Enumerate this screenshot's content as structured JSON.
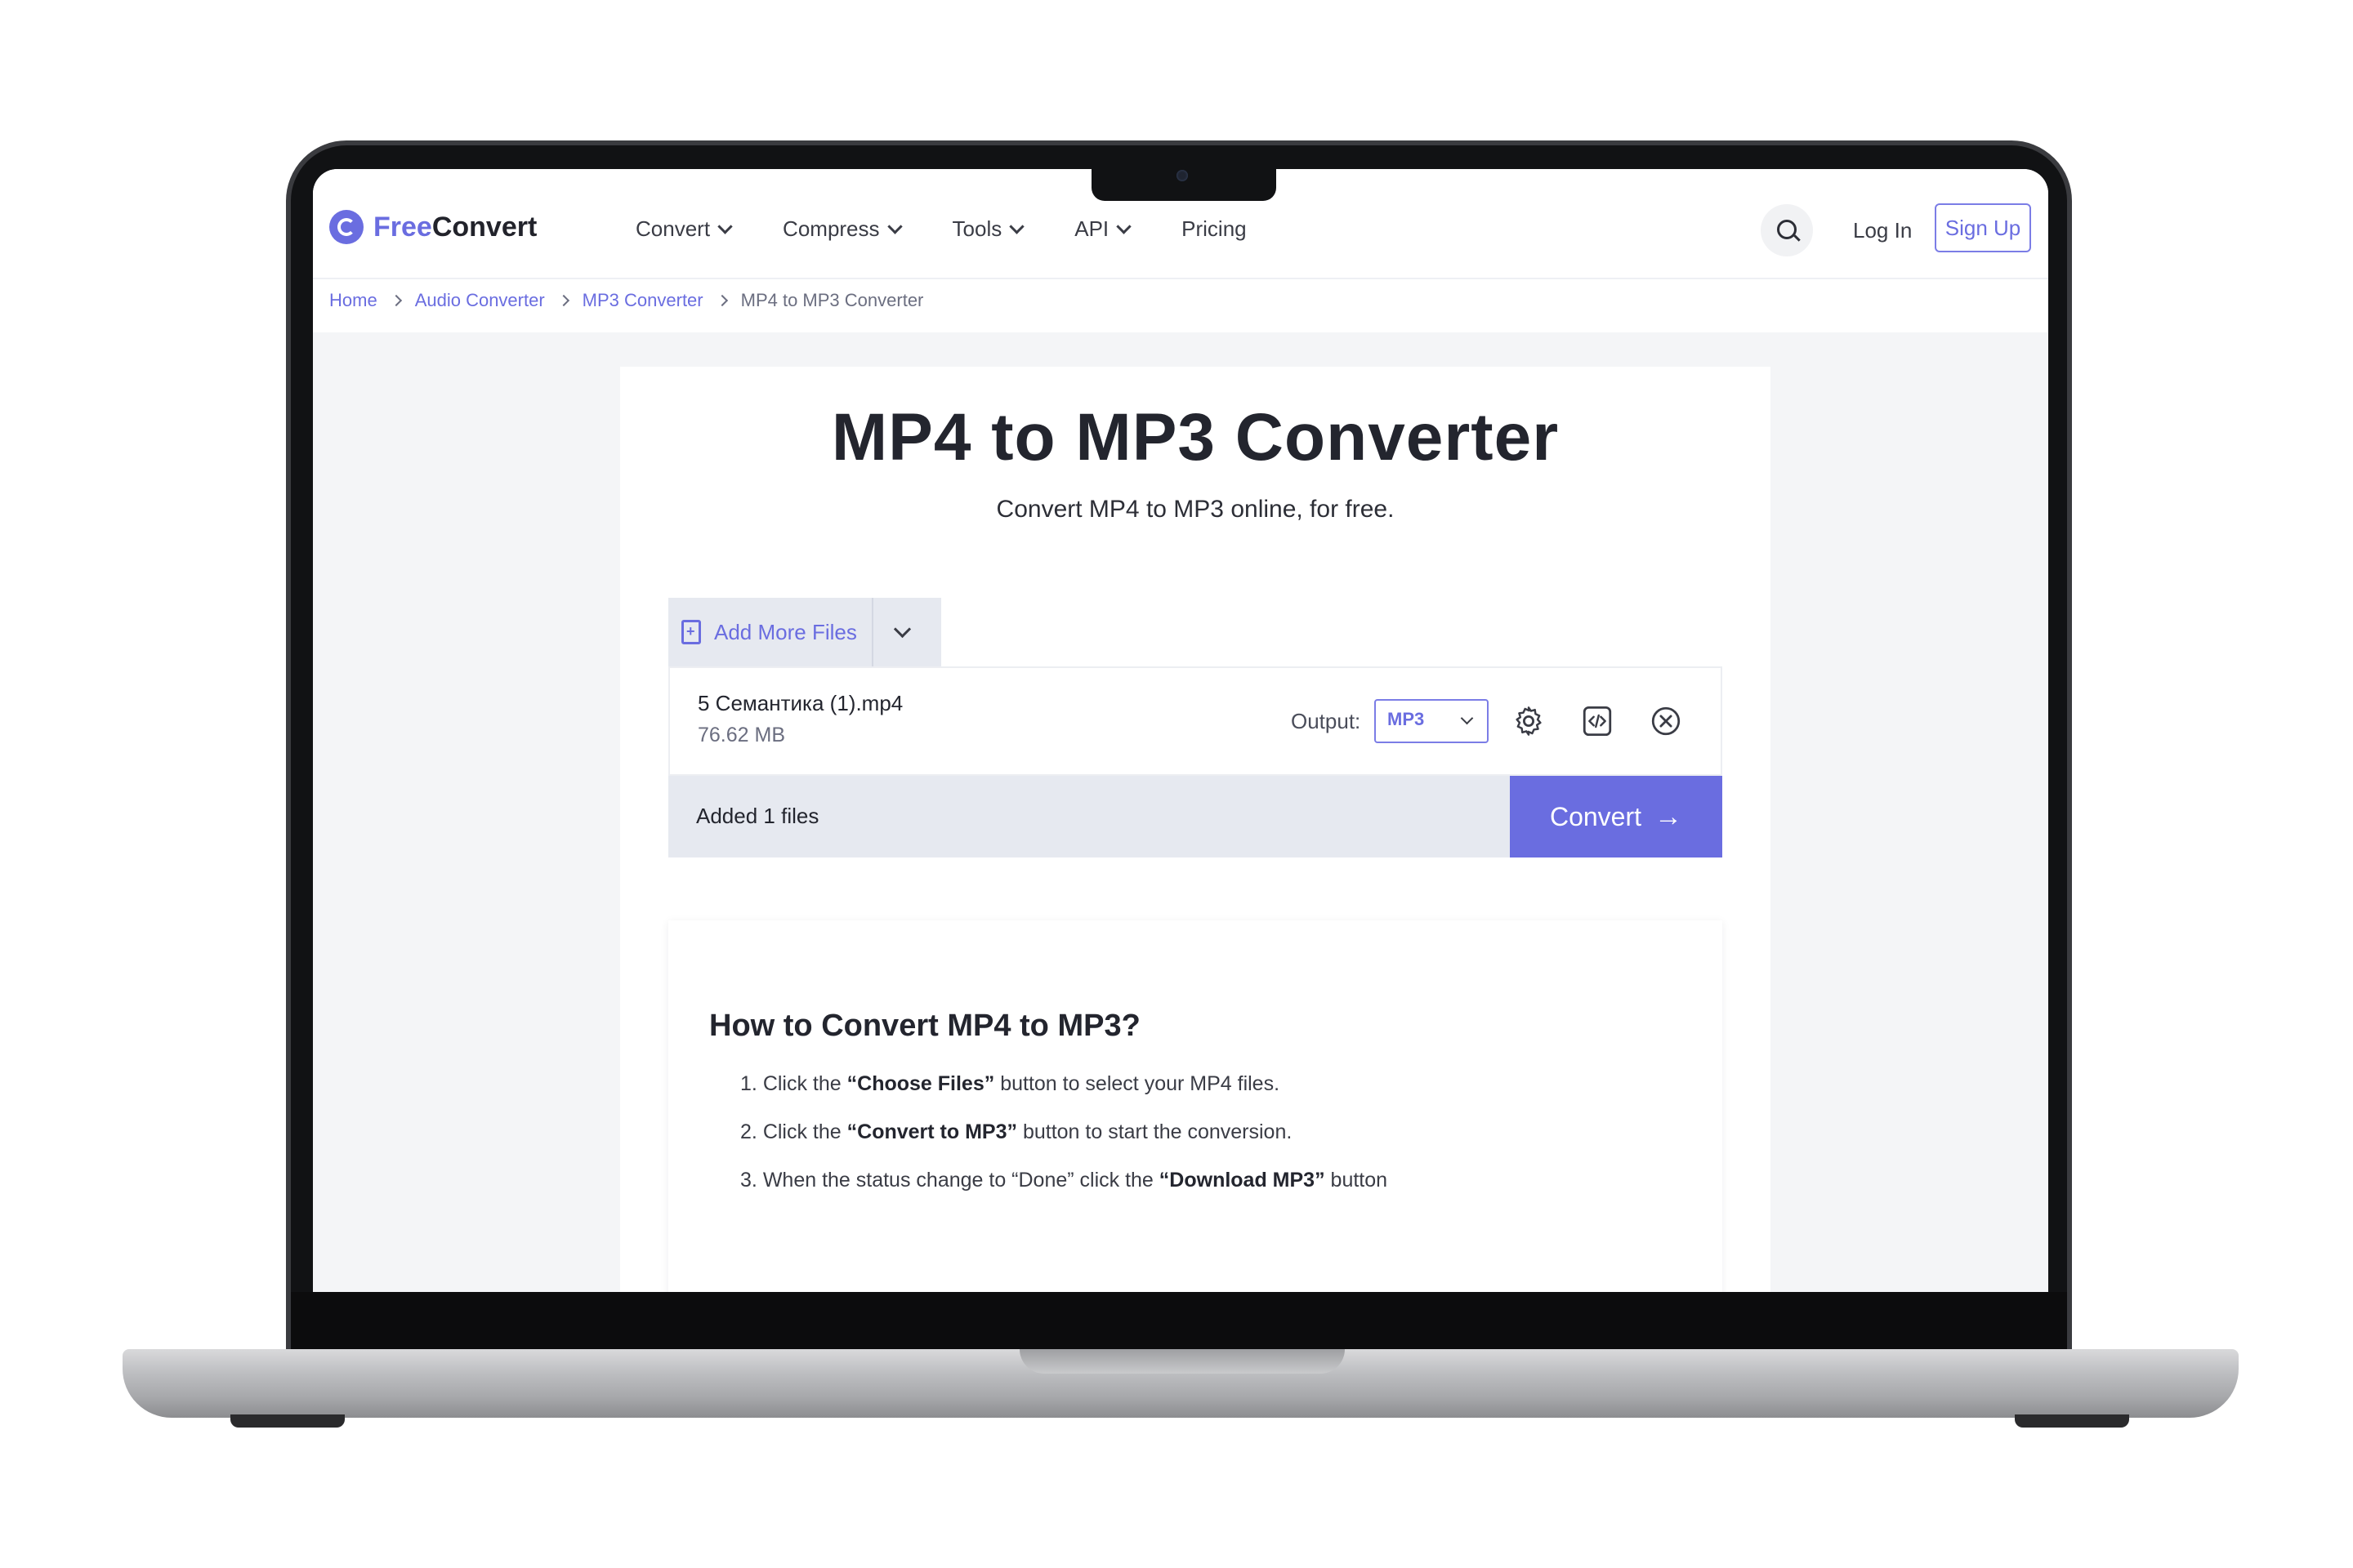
{
  "header": {
    "logo_free": "Free",
    "logo_convert": "Convert",
    "nav": [
      {
        "label": "Convert",
        "dropdown": true
      },
      {
        "label": "Compress",
        "dropdown": true
      },
      {
        "label": "Tools",
        "dropdown": true
      },
      {
        "label": "API",
        "dropdown": true
      },
      {
        "label": "Pricing",
        "dropdown": false
      }
    ],
    "login": "Log In",
    "signup": "Sign Up"
  },
  "breadcrumb": [
    "Home",
    "Audio Converter",
    "MP3 Converter",
    "MP4 to MP3 Converter"
  ],
  "main": {
    "title": "MP4 to MP3 Converter",
    "subtitle": "Convert MP4 to MP3 online, for free."
  },
  "uploader": {
    "add_more_files": "Add More Files",
    "file": {
      "name": "5 Семантика (1).mp4",
      "size": "76.62 MB"
    },
    "output_label": "Output:",
    "output_value": "MP3",
    "added_text": "Added 1 files",
    "convert_label": "Convert",
    "convert_arrow": "→"
  },
  "howto": {
    "title": "How to Convert MP4 to MP3?",
    "steps": [
      {
        "n": "1.",
        "pre": "Click the",
        "bold": "“Choose Files”",
        "post": "button to select your MP4 files."
      },
      {
        "n": "2.",
        "pre": "Click the",
        "bold": "“Convert to MP3”",
        "post": "button to start the conversion."
      },
      {
        "n": "3.",
        "pre": "When the status change to “Done” click the",
        "bold": "“Download MP3”",
        "post": "button"
      }
    ]
  },
  "colors": {
    "accent": "#6a6de0",
    "text": "#23252e",
    "panel_bg": "#e6e9f0",
    "page_bg": "#f4f5f7"
  },
  "icons": [
    "search-icon",
    "file-add-icon",
    "chevron-down-icon",
    "gear-icon",
    "code-embed-icon",
    "close-circle-icon",
    "arrow-right-icon"
  ]
}
